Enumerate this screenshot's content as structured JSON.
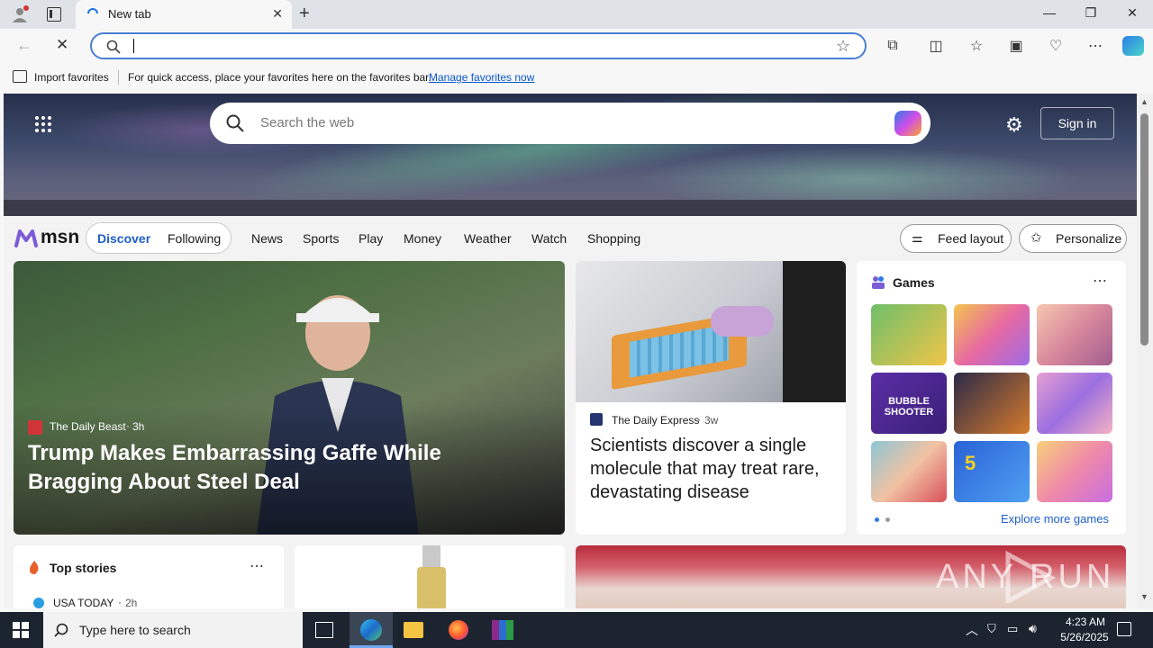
{
  "browser": {
    "tab_title": "New tab",
    "address_value": "",
    "favorites_import": "Import favorites",
    "favorites_hint": "For quick access, place your favorites here on the favorites bar.",
    "favorites_manage": "Manage favorites now"
  },
  "hero": {
    "search_placeholder": "Search the web",
    "signin": "Sign in"
  },
  "nav": {
    "brand": "msn",
    "discover": "Discover",
    "following": "Following",
    "items": [
      "News",
      "Sports",
      "Play",
      "Money",
      "Weather",
      "Watch",
      "Shopping"
    ],
    "feed_layout": "Feed layout",
    "personalize": "Personalize"
  },
  "main_story": {
    "source": "The Daily Beast",
    "age": "3h",
    "headline": "Trump Makes Embarrassing Gaffe While Bragging About Steel Deal"
  },
  "second_story": {
    "source": "The Daily Express",
    "age": "3w",
    "headline": "Scientists discover a single molecule that may treat rare, devastating disease"
  },
  "games": {
    "title": "Games",
    "explore": "Explore more games",
    "tiles": [
      "BUBBLE SHOOTER",
      "5"
    ]
  },
  "top_stories": {
    "title": "Top stories",
    "source": "USA TODAY",
    "age": "2h"
  },
  "watermark": "ANY RUN",
  "taskbar": {
    "search_placeholder": "Type here to search",
    "time": "4:23 AM",
    "date": "5/26/2025"
  }
}
